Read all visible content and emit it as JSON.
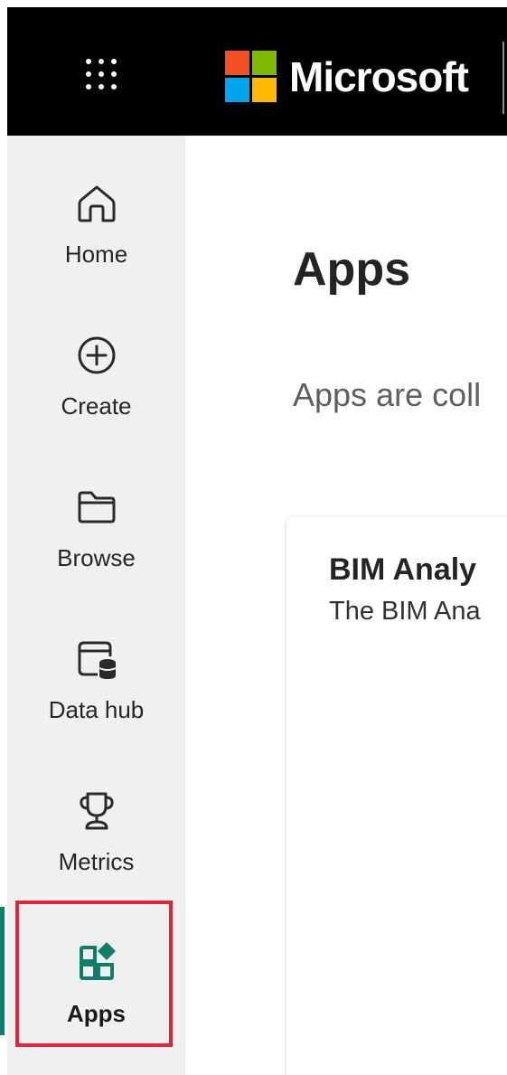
{
  "header": {
    "brand": "Microsoft",
    "app_launcher_icon": "waffle-icon",
    "logo_colors": [
      "#f25022",
      "#7fba00",
      "#00a4ef",
      "#ffb900"
    ]
  },
  "nav": {
    "items": [
      {
        "label": "Home",
        "icon": "home-icon"
      },
      {
        "label": "Create",
        "icon": "plus-circle-icon"
      },
      {
        "label": "Browse",
        "icon": "folder-icon"
      },
      {
        "label": "Data hub",
        "icon": "data-hub-icon"
      },
      {
        "label": "Metrics",
        "icon": "trophy-icon"
      },
      {
        "label": "Apps",
        "icon": "apps-icon",
        "active": true
      }
    ],
    "accent_color": "#0f7d6a",
    "highlight_color": "#e0253a"
  },
  "main": {
    "title": "Apps",
    "description": "Apps are coll",
    "cards": [
      {
        "title": "BIM Analy",
        "description": "The BIM Ana"
      }
    ]
  }
}
